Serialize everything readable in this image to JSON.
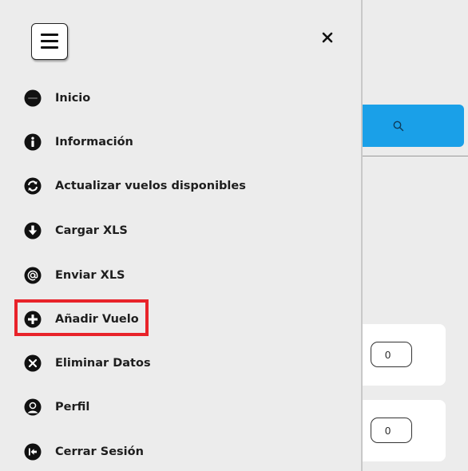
{
  "drawer": {
    "items": [
      {
        "label": "Inicio",
        "icon": "logo-icon"
      },
      {
        "label": "Información",
        "icon": "info-icon"
      },
      {
        "label": "Actualizar vuelos disponibles",
        "icon": "refresh-icon"
      },
      {
        "label": "Cargar XLS",
        "icon": "download-arrow-icon"
      },
      {
        "label": "Enviar XLS",
        "icon": "at-sign-icon"
      },
      {
        "label": "Añadir Vuelo",
        "icon": "plus-circle-icon"
      },
      {
        "label": "Eliminar Datos",
        "icon": "x-circle-icon"
      },
      {
        "label": "Perfil",
        "icon": "user-icon"
      },
      {
        "label": "Cerrar Sesión",
        "icon": "logout-icon"
      }
    ],
    "highlighted_item": "Añadir Vuelo"
  },
  "background": {
    "counters": [
      "0",
      "0"
    ]
  },
  "colors": {
    "search_button": "#1aa0e8",
    "highlight_border": "#e8232a",
    "drawer_bg": "#ececec"
  }
}
